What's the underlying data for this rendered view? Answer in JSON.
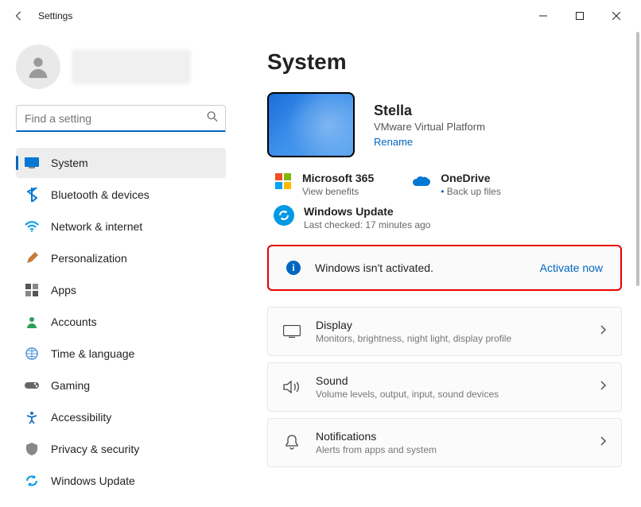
{
  "app_title": "Settings",
  "search": {
    "placeholder": "Find a setting"
  },
  "nav": [
    {
      "key": "system",
      "label": "System",
      "active": true
    },
    {
      "key": "bluetooth",
      "label": "Bluetooth & devices"
    },
    {
      "key": "network",
      "label": "Network & internet"
    },
    {
      "key": "personalization",
      "label": "Personalization"
    },
    {
      "key": "apps",
      "label": "Apps"
    },
    {
      "key": "accounts",
      "label": "Accounts"
    },
    {
      "key": "time",
      "label": "Time & language"
    },
    {
      "key": "gaming",
      "label": "Gaming"
    },
    {
      "key": "accessibility",
      "label": "Accessibility"
    },
    {
      "key": "privacy",
      "label": "Privacy & security"
    },
    {
      "key": "update",
      "label": "Windows Update"
    }
  ],
  "page": {
    "title": "System"
  },
  "device": {
    "name": "Stella",
    "platform": "VMware Virtual Platform",
    "rename_label": "Rename"
  },
  "services": {
    "m365": {
      "title": "Microsoft 365",
      "sub": "View benefits"
    },
    "onedrive": {
      "title": "OneDrive",
      "sub": "Back up files"
    }
  },
  "update": {
    "title": "Windows Update",
    "sub": "Last checked: 17 minutes ago"
  },
  "activation": {
    "message": "Windows isn't activated.",
    "action": "Activate now"
  },
  "cards": {
    "display": {
      "title": "Display",
      "sub": "Monitors, brightness, night light, display profile"
    },
    "sound": {
      "title": "Sound",
      "sub": "Volume levels, output, input, sound devices"
    },
    "notifications": {
      "title": "Notifications",
      "sub": "Alerts from apps and system"
    }
  },
  "colors": {
    "accent": "#0067c0",
    "highlight_border": "#e60000"
  }
}
